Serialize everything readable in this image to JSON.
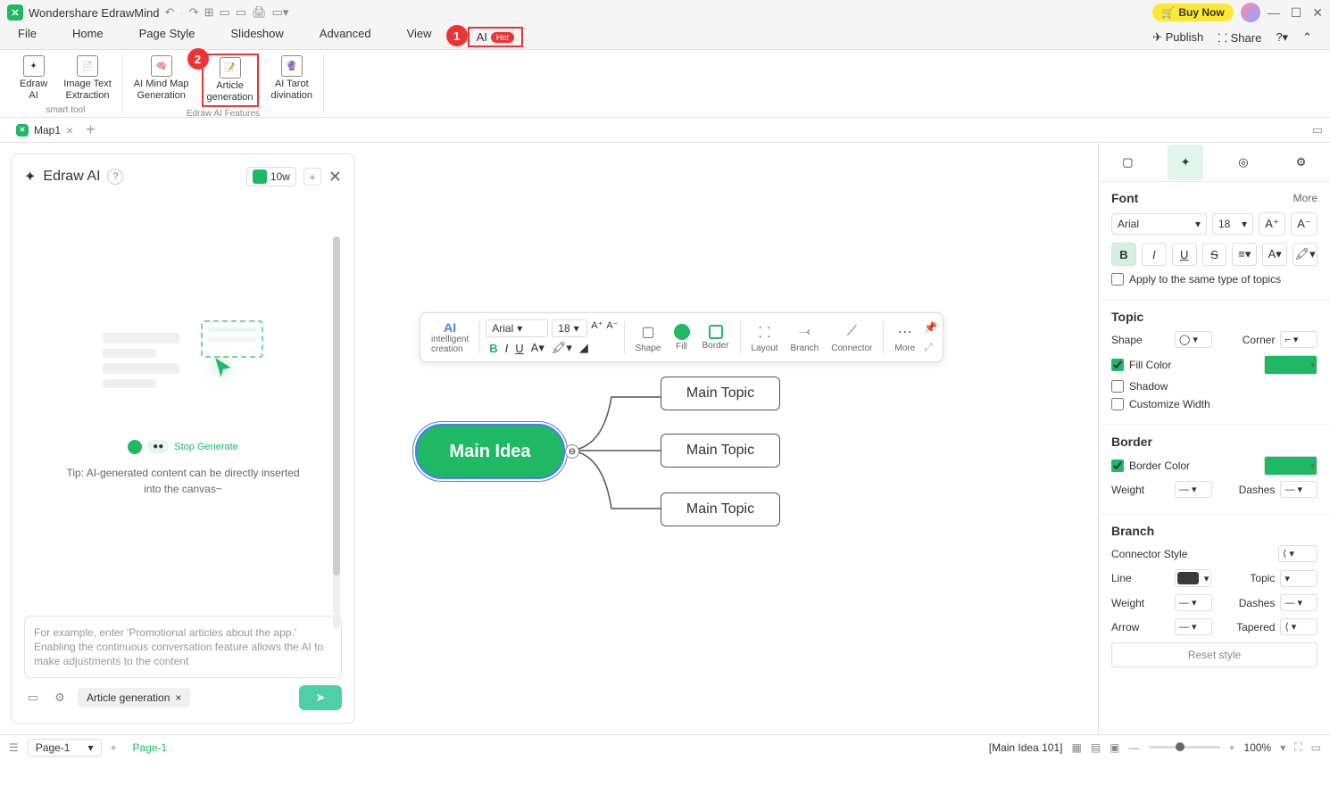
{
  "app": {
    "title": "Wondershare EdrawMind",
    "buy": "Buy Now"
  },
  "winControls": {
    "min": "—",
    "max": "☐",
    "close": "✕"
  },
  "menu": {
    "file": "File",
    "home": "Home",
    "pageStyle": "Page Style",
    "slideshow": "Slideshow",
    "advanced": "Advanced",
    "view": "View",
    "ai": "AI",
    "hot": "Hot"
  },
  "menuRight": {
    "publish": "Publish",
    "share": "Share"
  },
  "ribbon": {
    "smartTool": "smart tool",
    "edrawAI": "Edraw\nAI",
    "imageText": "Image Text\nExtraction",
    "aiMindMap": "AI Mind Map\nGeneration",
    "article": "Article\ngeneration",
    "tarot": "AI Tarot\ndivination",
    "features": "Edraw AI Features"
  },
  "tabs": {
    "map1": "Map1"
  },
  "aiPanel": {
    "title": "Edraw AI",
    "tokens": "10w",
    "stopGen": "Stop Generate",
    "tip": "Tip: AI-generated content can be directly inserted into the canvas~",
    "placeholder": "For example, enter 'Promotional articles about the app.' Enabling the continuous conversation feature allows the AI to make adjustments to the content",
    "tag": "Article generation"
  },
  "floatToolbar": {
    "intelligent": "intelligent\ncreation",
    "font": "Arial",
    "size": "18",
    "shape": "Shape",
    "fill": "Fill",
    "border": "Border",
    "layout": "Layout",
    "branch": "Branch",
    "connector": "Connector",
    "more": "More"
  },
  "mindmap": {
    "main": "Main Idea",
    "topic": "Main Topic"
  },
  "rightPanel": {
    "font": {
      "title": "Font",
      "more": "More",
      "family": "Arial",
      "size": "18",
      "apply": "Apply to the same type of topics"
    },
    "topic": {
      "title": "Topic",
      "shape": "Shape",
      "corner": "Corner",
      "fillColor": "Fill Color",
      "shadow": "Shadow",
      "customWidth": "Customize Width"
    },
    "border": {
      "title": "Border",
      "borderColor": "Border Color",
      "weight": "Weight",
      "dashes": "Dashes"
    },
    "branch": {
      "title": "Branch",
      "connStyle": "Connector Style",
      "line": "Line",
      "topic": "Topic",
      "weight": "Weight",
      "dashes": "Dashes",
      "arrow": "Arrow",
      "tapered": "Tapered"
    },
    "reset": "Reset style"
  },
  "statusbar": {
    "pageSelect": "Page-1",
    "pageTab": "Page-1",
    "context": "[Main Idea 101]",
    "zoom": "100%"
  }
}
